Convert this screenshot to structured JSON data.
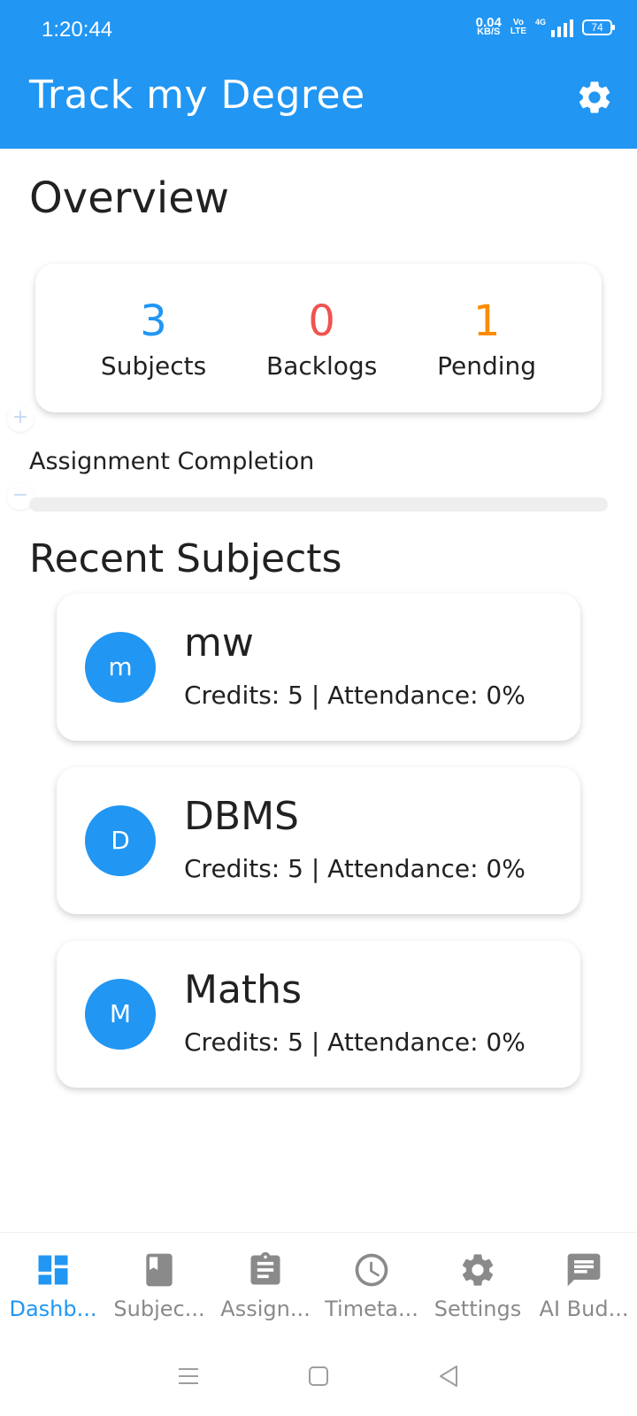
{
  "status_bar": {
    "time": "1:20:44",
    "net_speed_value": "0.04",
    "net_speed_unit": "KB/S",
    "volte_top": "Vo",
    "volte_bottom": "LTE",
    "network": "4G",
    "battery": "74"
  },
  "app_bar": {
    "title": "Track my Degree",
    "settings_icon": "gear-icon"
  },
  "overview": {
    "heading": "Overview",
    "stats": [
      {
        "value": "3",
        "label": "Subjects",
        "color": "#2196F3"
      },
      {
        "value": "0",
        "label": "Backlogs",
        "color": "#EF5350"
      },
      {
        "value": "1",
        "label": "Pending",
        "color": "#FB8C00"
      }
    ],
    "assignment_completion_label": "Assignment Completion",
    "assignment_completion_fraction": 0.0
  },
  "recent_subjects": {
    "heading": "Recent Subjects",
    "items": [
      {
        "initial": "m",
        "name": "mw",
        "details": "Credits: 5 | Attendance: 0%"
      },
      {
        "initial": "D",
        "name": "DBMS",
        "details": "Credits: 5 | Attendance: 0%"
      },
      {
        "initial": "M",
        "name": "Maths",
        "details": "Credits: 5 | Attendance: 0%"
      }
    ]
  },
  "bottom_nav": {
    "items": [
      {
        "label": "Dashb...",
        "icon": "dashboard-icon",
        "active": true
      },
      {
        "label": "Subjec...",
        "icon": "book-icon",
        "active": false
      },
      {
        "label": "Assign...",
        "icon": "clipboard-icon",
        "active": false
      },
      {
        "label": "Timeta...",
        "icon": "clock-icon",
        "active": false
      },
      {
        "label": "Settings",
        "icon": "gear-icon",
        "active": false
      },
      {
        "label": "AI Bud...",
        "icon": "chat-icon",
        "active": false
      }
    ]
  },
  "colors": {
    "primary": "#2196F3",
    "backlogs": "#EF5350",
    "pending": "#FB8C00"
  }
}
